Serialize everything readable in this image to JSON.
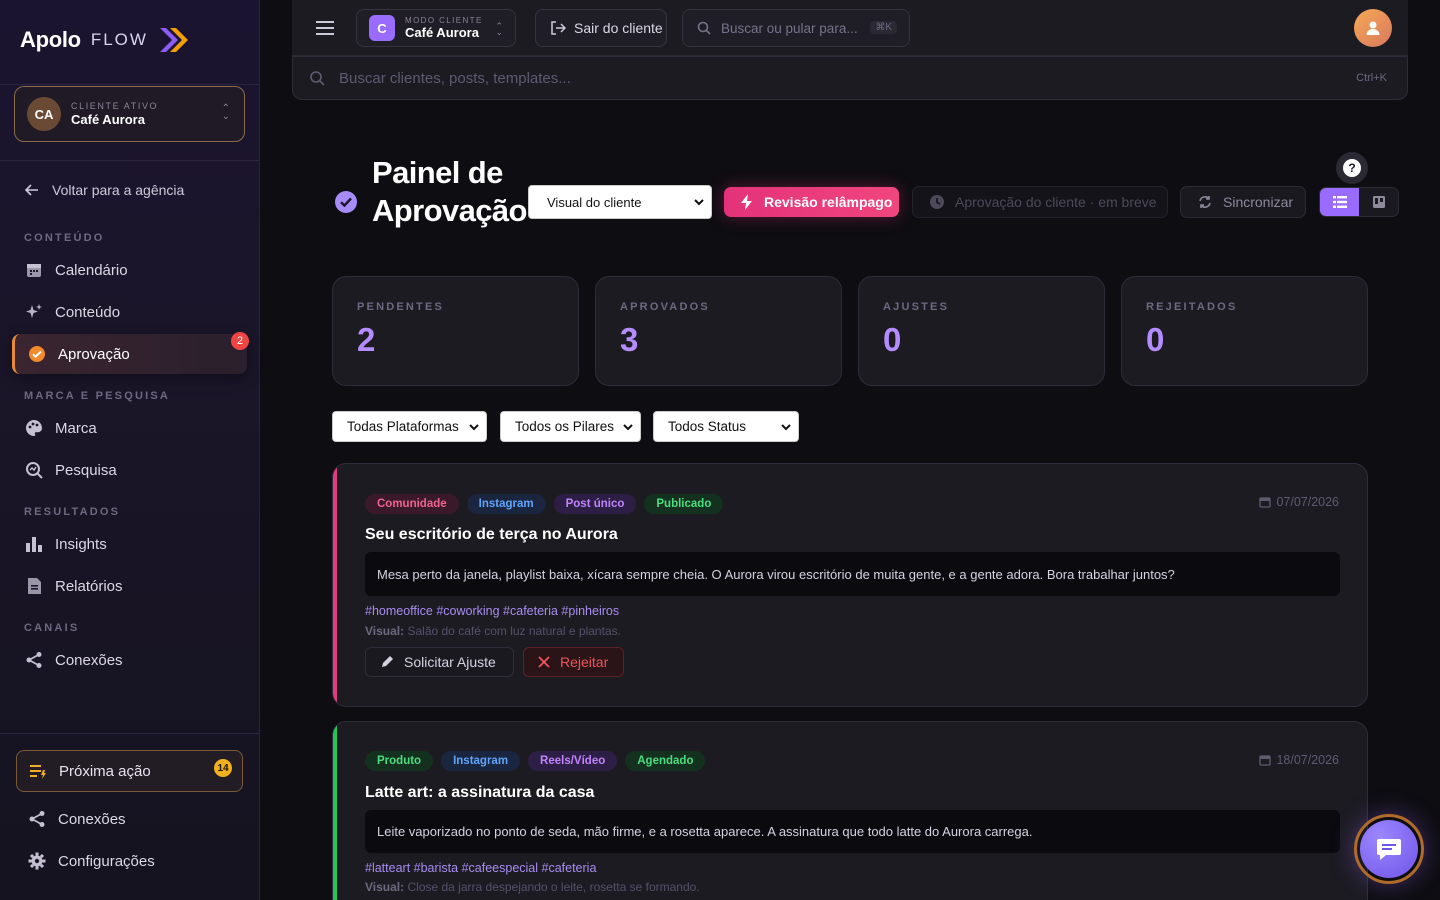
{
  "brand": {
    "name": "Apolo",
    "suffix": "FLOW"
  },
  "client": {
    "label": "CLIENTE ATIVO",
    "name": "Café Aurora",
    "initials": "CA"
  },
  "sidebar": {
    "back": "Voltar para a agência",
    "sections": {
      "content": "CONTEÚDO",
      "brand": "MARCA E PESQUISA",
      "results": "RESULTADOS",
      "channels": "CANAIS"
    },
    "items": {
      "calendar": "Calendário",
      "content": "Conteúdo",
      "approval": "Aprovação",
      "approval_badge": "2",
      "brand": "Marca",
      "research": "Pesquisa",
      "insights": "Insights",
      "reports": "Relatórios",
      "connections": "Conexões"
    },
    "next_action": {
      "label": "Próxima ação",
      "badge": "14"
    },
    "bottom": {
      "connections": "Conexões",
      "settings": "Configurações"
    }
  },
  "topbar": {
    "mode_label": "MODO CLIENTE",
    "mode_initial": "C",
    "mode_client": "Café Aurora",
    "exit": "Sair do cliente",
    "search_placeholder": "Buscar ou pular para...",
    "search_kbd": "⌘K"
  },
  "global_search": {
    "placeholder": "Buscar clientes, posts, templates...",
    "shortcut": "Ctrl+K"
  },
  "header": {
    "title_line1": "Painel de",
    "title_line2": "Aprovação",
    "view_select": "Visual do cliente",
    "flash_review": "Revisão relâmpago",
    "client_approval_soon": "Aprovação do cliente · em breve",
    "sync": "Sincronizar",
    "help": "?"
  },
  "stats": [
    {
      "label": "PENDENTES",
      "value": "2"
    },
    {
      "label": "APROVADOS",
      "value": "3"
    },
    {
      "label": "AJUSTES",
      "value": "0"
    },
    {
      "label": "REJEITADOS",
      "value": "0"
    }
  ],
  "filters": {
    "platforms": "Todas Plataformas",
    "pillars": "Todos os Pilares",
    "status": "Todos Status"
  },
  "posts": [
    {
      "accent": "#e23b82",
      "tags": [
        "Comunidade",
        "Instagram",
        "Post único",
        "Publicado"
      ],
      "date": "07/07/2026",
      "title": "Seu escritório de terça no Aurora",
      "body": "Mesa perto da janela, playlist baixa, xícara sempre cheia. O Aurora virou escritório de muita gente, e a gente adora. Bora trabalhar juntos?",
      "hashtags": "#homeoffice #coworking #cafeteria #pinheiros",
      "visual_label": "Visual:",
      "visual": "Salão do café com luz natural e plantas.",
      "adjust": "Solicitar Ajuste",
      "reject": "Rejeitar"
    },
    {
      "accent": "#22c55e",
      "tags": [
        "Produto",
        "Instagram",
        "Reels/Vídeo",
        "Agendado"
      ],
      "date": "18/07/2026",
      "title": "Latte art: a assinatura da casa",
      "body": "Leite vaporizado no ponto de seda, mão firme, e a rosetta aparece. A assinatura que todo latte do Aurora carrega.",
      "hashtags": "#latteart #barista #cafeespecial #cafeteria",
      "visual_label": "Visual:",
      "visual": "Close da jarra despejando o leite, rosetta se formando."
    }
  ]
}
